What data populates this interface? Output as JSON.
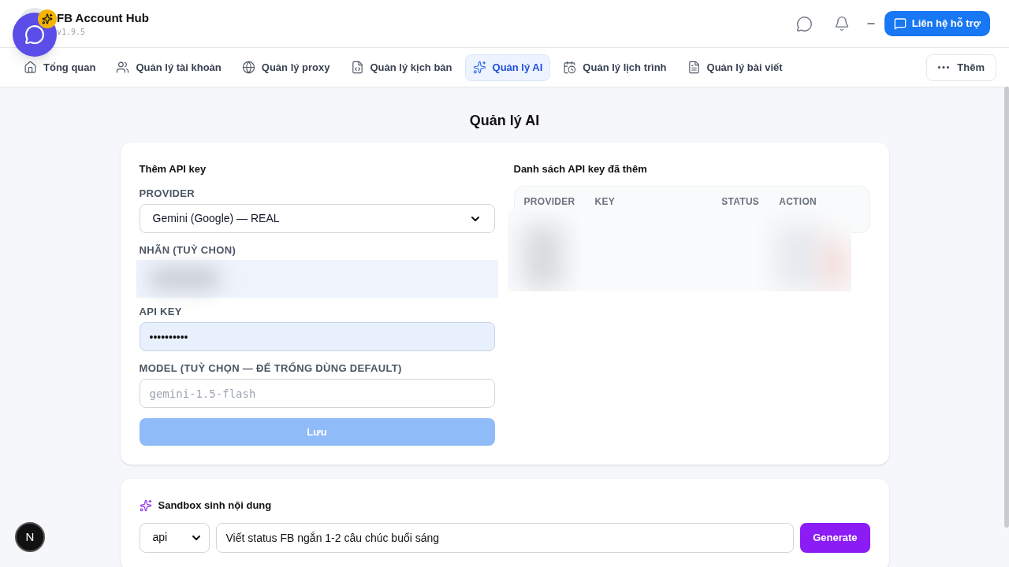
{
  "app": {
    "title": "FB Account Hub",
    "version": "v1.9.5"
  },
  "header": {
    "support_button": "Liên hệ hỗ trợ"
  },
  "nav": {
    "tabs": [
      {
        "label": "Tổng quan",
        "selected": false
      },
      {
        "label": "Quản lý tài khoản",
        "selected": false
      },
      {
        "label": "Quản lý proxy",
        "selected": false
      },
      {
        "label": "Quản lý kịch bản",
        "selected": false
      },
      {
        "label": "Quản lý AI",
        "selected": true
      },
      {
        "label": "Quản lý lịch trình",
        "selected": false
      },
      {
        "label": "Quản lý bài viết",
        "selected": false
      }
    ],
    "more": "Thêm"
  },
  "page_title": "Quản lý AI",
  "add_form": {
    "title": "Thêm API key",
    "fields": [
      {
        "kind": "select",
        "label": "PROVIDER",
        "value": "Gemini (Google) — REAL"
      },
      {
        "kind": "blurred",
        "label": "NHÃN (TUỲ CHON)"
      },
      {
        "kind": "password",
        "label": "API KEY",
        "value": "••••••••••"
      },
      {
        "kind": "text",
        "label": "MODEL (TUỲ CHỌN — ĐỂ TRỐNG DÙNG DEFAULT)",
        "placeholder": "gemini-1.5-flash"
      }
    ],
    "submit": {
      "label": "Lưu",
      "disabled": true
    }
  },
  "key_list": {
    "title": "Danh sách API key đã thêm",
    "columns": [
      "PROVIDER",
      "KEY",
      "STATUS",
      "ACTION"
    ]
  },
  "sandbox": {
    "title": "Sandbox sinh nội dung",
    "mode": "api",
    "prompt": "Viết status FB ngắn 1-2 câu chúc buổi sáng",
    "button": "Generate"
  },
  "dev_badge": "N"
}
